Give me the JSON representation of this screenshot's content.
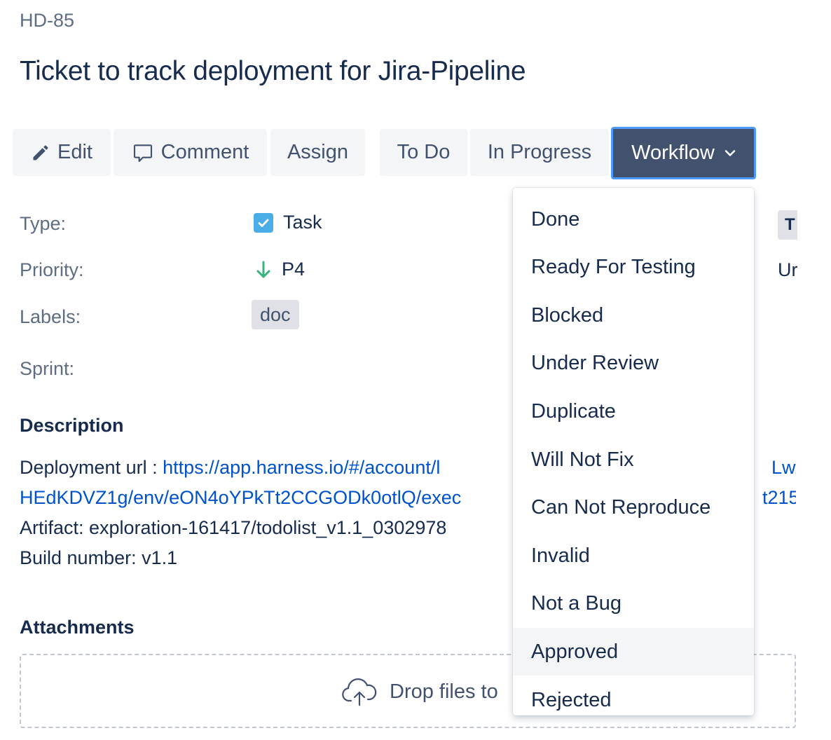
{
  "issue": {
    "key": "HD-85",
    "title": "Ticket to track deployment for Jira-Pipeline"
  },
  "toolbar": {
    "edit_label": "Edit",
    "comment_label": "Comment",
    "assign_label": "Assign",
    "todo_label": "To Do",
    "in_progress_label": "In Progress",
    "workflow_label": "Workflow"
  },
  "details": {
    "type_label": "Type:",
    "type_value": "Task",
    "priority_label": "Priority:",
    "priority_value": "P4",
    "labels_label": "Labels:",
    "labels_value": "doc",
    "sprint_label": "Sprint:",
    "right_chip_text": "T",
    "right_text": "Ur"
  },
  "description": {
    "heading": "Description",
    "url_prefix": "Deployment url : ",
    "url_part1": "https://app.harness.io/#/account/l",
    "url_part1_tail": "Lw/a",
    "url_part2": "HEdKDVZ1g/env/eON4oYPkTt2CCGODk0otlQ/exec",
    "url_part2_tail": "t215",
    "artifact": "Artifact: exploration-161417/todolist_v1.1_0302978",
    "build": "Build number: v1.1"
  },
  "attachments": {
    "heading": "Attachments",
    "drop_text": "Drop files to"
  },
  "workflow_menu": {
    "items": [
      {
        "label": "Done"
      },
      {
        "label": "Ready For Testing"
      },
      {
        "label": "Blocked"
      },
      {
        "label": "Under Review"
      },
      {
        "label": "Duplicate"
      },
      {
        "label": "Will Not Fix"
      },
      {
        "label": "Can Not Reproduce"
      },
      {
        "label": "Invalid"
      },
      {
        "label": "Not a Bug"
      },
      {
        "label": "Approved"
      },
      {
        "label": "Rejected"
      }
    ],
    "hovered": "Approved"
  },
  "colors": {
    "link": "#0052cc",
    "workflow_bg": "#42526e",
    "focus_ring": "#4c9aff",
    "task_icon": "#4bade8",
    "priority_low": "#36b37e"
  }
}
